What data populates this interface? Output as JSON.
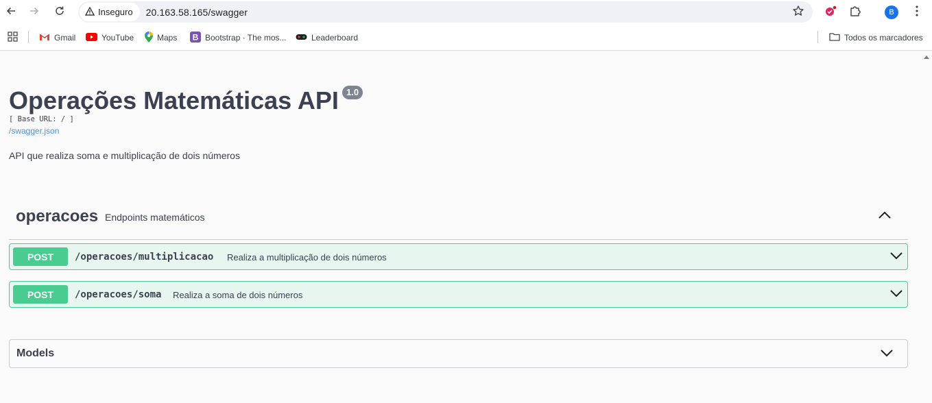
{
  "browser": {
    "security_label": "Inseguro",
    "url": "20.163.58.165/swagger",
    "profile_initial": "B"
  },
  "bookmarks": {
    "items": [
      {
        "label": "Gmail",
        "icon": "gmail-icon"
      },
      {
        "label": "YouTube",
        "icon": "youtube-icon"
      },
      {
        "label": "Maps",
        "icon": "maps-icon"
      },
      {
        "label": "Bootstrap · The mos...",
        "icon": "bootstrap-icon"
      },
      {
        "label": "Leaderboard",
        "icon": "leaderboard-icon"
      }
    ],
    "all_bookmarks_label": "Todos os marcadores"
  },
  "swagger": {
    "title": "Operações Matemáticas API",
    "version": "1.0",
    "base_url": "[ Base URL: / ]",
    "spec_link": "/swagger.json",
    "description": "API que realiza soma e multiplicação de dois números",
    "tag": {
      "name": "operacoes",
      "description": "Endpoints matemáticos"
    },
    "operations": [
      {
        "method": "POST",
        "path": "/operacoes/multiplicacao",
        "summary": "Realiza a multiplicação de dois números"
      },
      {
        "method": "POST",
        "path": "/operacoes/soma",
        "summary": "Realiza a soma de dois números"
      }
    ],
    "models_label": "Models"
  },
  "colors": {
    "post_method": "#49cc90",
    "post_background": "#e8f6f0",
    "text_primary": "#3b4151",
    "link": "#4990e2"
  }
}
